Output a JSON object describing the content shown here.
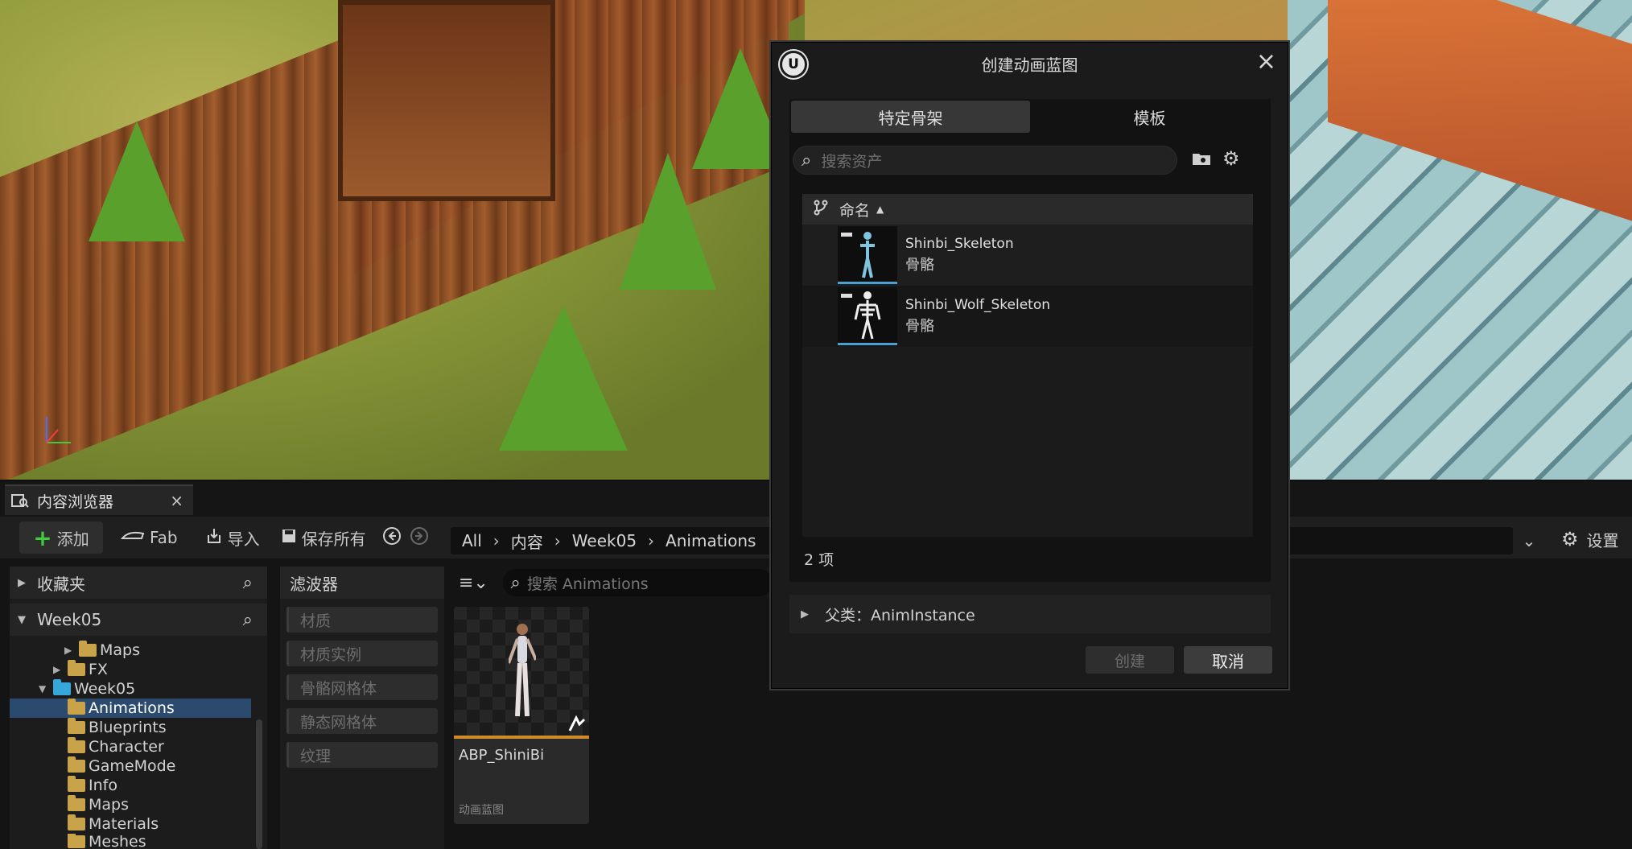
{
  "content_browser": {
    "tab_title": "内容浏览器",
    "toolbar": {
      "add_label": "添加",
      "fab_label": "Fab",
      "import_label": "导入",
      "save_all_label": "保存所有",
      "settings_label": "设置"
    },
    "breadcrumbs": [
      "All",
      "内容",
      "Week05",
      "Animations"
    ],
    "favorites_label": "收藏夹",
    "project_label": "Week05",
    "tree": [
      {
        "label": "Maps",
        "depth": 3,
        "expandable": true,
        "open": false
      },
      {
        "label": "FX",
        "depth": 2,
        "expandable": true,
        "open": false
      },
      {
        "label": "Week05",
        "depth": 1,
        "expandable": true,
        "open": true
      },
      {
        "label": "Animations",
        "depth": 2,
        "expandable": false,
        "selected": true
      },
      {
        "label": "Blueprints",
        "depth": 2,
        "expandable": false
      },
      {
        "label": "Character",
        "depth": 2,
        "expandable": false
      },
      {
        "label": "GameMode",
        "depth": 2,
        "expandable": false
      },
      {
        "label": "Info",
        "depth": 2,
        "expandable": false
      },
      {
        "label": "Maps",
        "depth": 2,
        "expandable": false
      },
      {
        "label": "Materials",
        "depth": 2,
        "expandable": false
      },
      {
        "label": "Meshes",
        "depth": 2,
        "expandable": false
      }
    ],
    "filters_label": "滤波器",
    "filters": [
      "材质",
      "材质实例",
      "骨骼网格体",
      "静态网格体",
      "纹理"
    ],
    "search_placeholder": "搜索 Animations",
    "asset": {
      "name": "ABP_ShiniBi",
      "type": "动画蓝图"
    }
  },
  "dialog": {
    "title": "创建动画蓝图",
    "tabs": [
      "特定骨架",
      "模板"
    ],
    "search_placeholder": "搜索资产",
    "column_name": "命名",
    "items": [
      {
        "name": "Shinbi_Skeleton",
        "type": "骨骼"
      },
      {
        "name": "Shinbi_Wolf_Skeleton",
        "type": "骨骼"
      }
    ],
    "count_label": "2 项",
    "parent_label": "父类：AnimInstance",
    "create_label": "创建",
    "cancel_label": "取消"
  },
  "colors": {
    "accent_selected": "#2b4a6e",
    "add_plus": "#3ecc3e",
    "asset_underline": "#d08a2a",
    "skeleton_underline": "#4aa0d0"
  }
}
